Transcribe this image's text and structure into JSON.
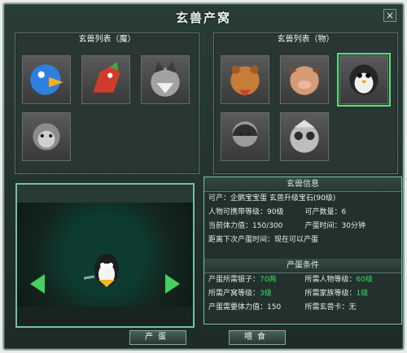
{
  "window": {
    "title": "玄兽产窝",
    "close": "×"
  },
  "left_panel": {
    "title": "玄兽列表（魔）",
    "pets": [
      {
        "name": "bird-pet",
        "color": "#2d7fe0"
      },
      {
        "name": "dragon-pet",
        "color": "#cf3c2b"
      },
      {
        "name": "wolf-pet",
        "color": "#9a9a9a"
      },
      {
        "name": "monkey-pet",
        "color": "#8c8c8c"
      }
    ]
  },
  "right_panel": {
    "title": "玄兽列表（物）",
    "pets": [
      {
        "name": "bear-pet",
        "color": "#c67d37"
      },
      {
        "name": "pig-pet",
        "color": "#d49b75"
      },
      {
        "name": "penguin-pet",
        "color": "#f1f1f1",
        "selected": true
      },
      {
        "name": "woman-pet",
        "color": "#9b9b9b"
      },
      {
        "name": "panda-pet",
        "color": "#bdbdbd"
      }
    ]
  },
  "info": {
    "title": "玄兽信息",
    "can_produce_label": "可产：",
    "can_produce_value": "企鹅宝宝蛋  玄兽升级宝石(90级)",
    "rows": [
      {
        "left": "人物可携带等级：",
        "left_val": "90级",
        "right": "可产数量：",
        "right_val": "6"
      },
      {
        "left": "当前体力值：",
        "left_val": "150/300",
        "right": "产蛋时间：",
        "right_val": "30分钟"
      }
    ],
    "next_label": "距离下次产蛋时间：",
    "next_value": "现在可以产蛋",
    "cond_title": "产蛋条件",
    "conds": [
      {
        "left": "产蛋所需银子：",
        "left_val": "70两",
        "right": "所需人物等级：",
        "right_val": "60级"
      },
      {
        "left": "所需产窝等级：",
        "left_val": "3级",
        "right": "所需家族等级：",
        "right_val": "1级"
      },
      {
        "left": "产蛋需要体力值：",
        "left_val": "150",
        "right": "所需玄兽卡：",
        "right_val": "无"
      }
    ]
  },
  "buttons": {
    "produce": "产蛋",
    "feed": "喂食"
  }
}
